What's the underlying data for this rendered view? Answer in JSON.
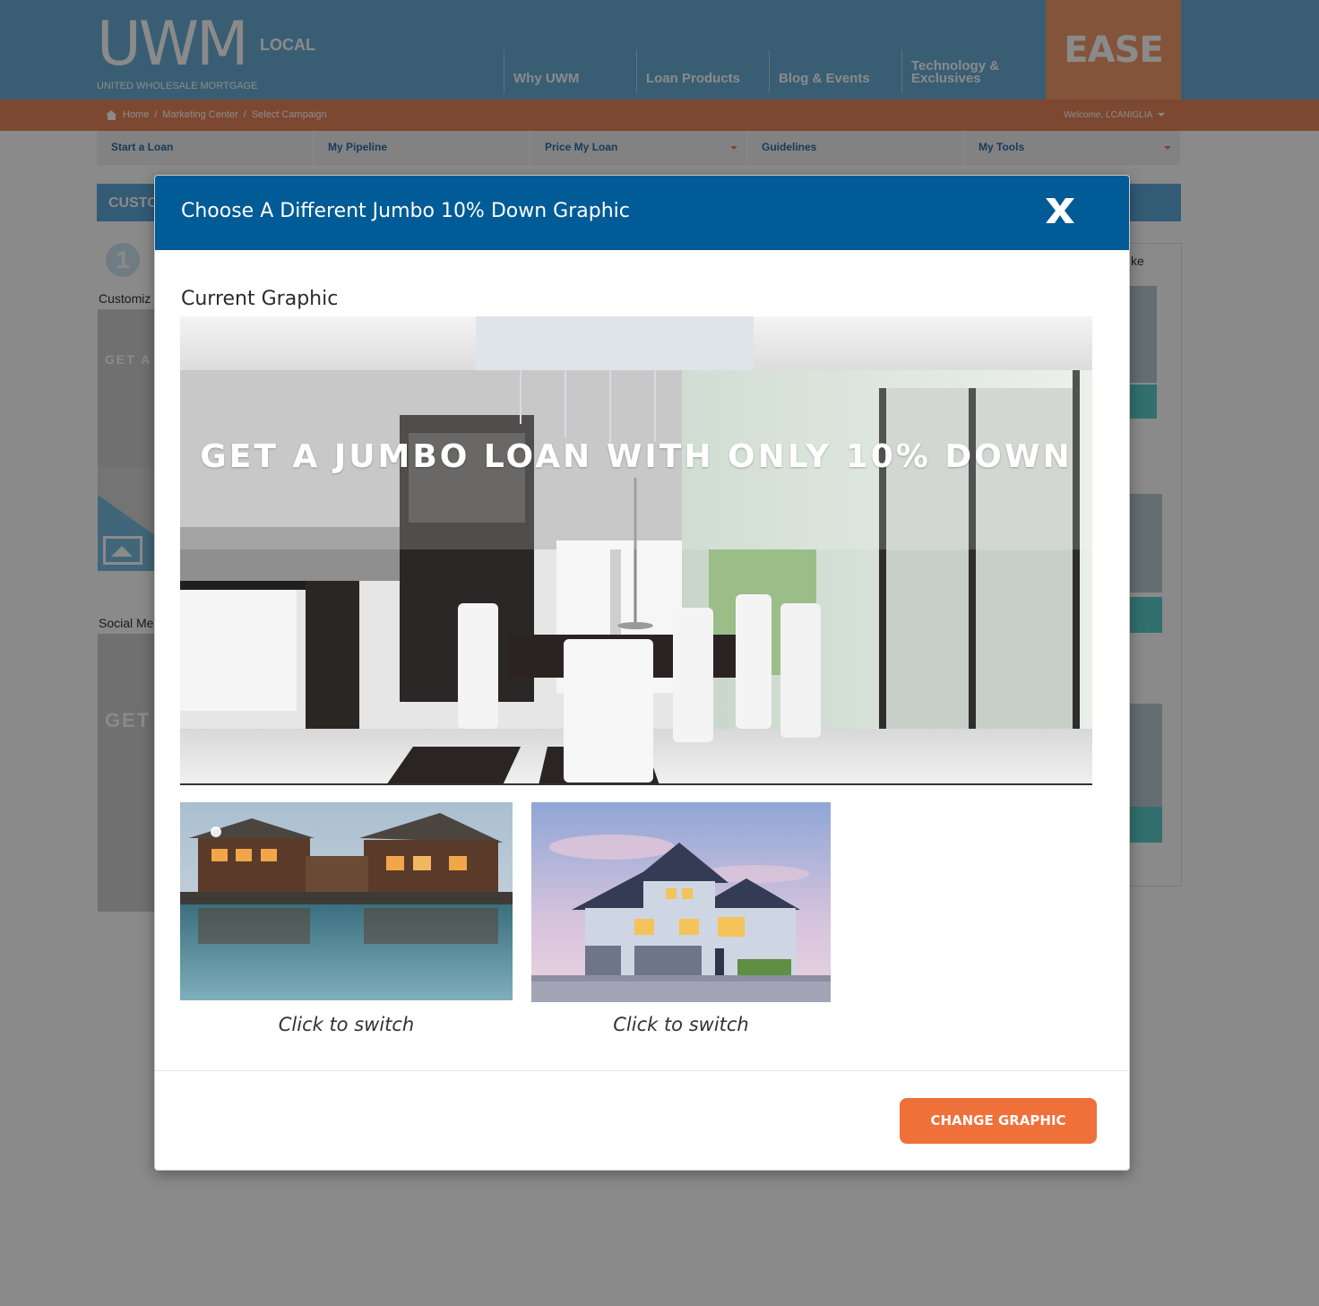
{
  "header": {
    "logo_main": "UWM",
    "logo_badge": "LOCAL",
    "logo_sub": "UNITED WHOLESALE MORTGAGE",
    "nav": [
      "Why UWM",
      "Loan Products",
      "Blog & Events",
      "Technology & Exclusives"
    ],
    "ease_label": "EASE"
  },
  "breadcrumb": {
    "items": [
      "Home",
      "Marketing Center",
      "Select Campaign"
    ],
    "separator": "/"
  },
  "welcome": "Welcome, LCANIGLIA",
  "subnav": [
    "Start a Loan",
    "My Pipeline",
    "Price My Loan",
    "Guidelines",
    "My Tools"
  ],
  "background": {
    "section_bar": "CUSTO",
    "step_number": "1",
    "label_customize": "Customiz",
    "label_social": "Social Me",
    "thumb_text_1": "GET A J",
    "thumb_text_2": "GET",
    "right_partial": "ke"
  },
  "modal": {
    "title": "Choose A Different Jumbo 10% Down Graphic",
    "close_label": "X",
    "current_label": "Current Graphic",
    "current_banner_text": "GET A JUMBO LOAN WITH ONLY 10% DOWN",
    "options": [
      {
        "caption": "Click to switch"
      },
      {
        "caption": "Click to switch"
      }
    ],
    "button_label": "CHANGE GRAPHIC"
  },
  "colors": {
    "header_blue": "#6aaed6",
    "breadcrumb_orange": "#e8865b",
    "modal_header": "#005b96",
    "button_orange": "#f0703a"
  }
}
